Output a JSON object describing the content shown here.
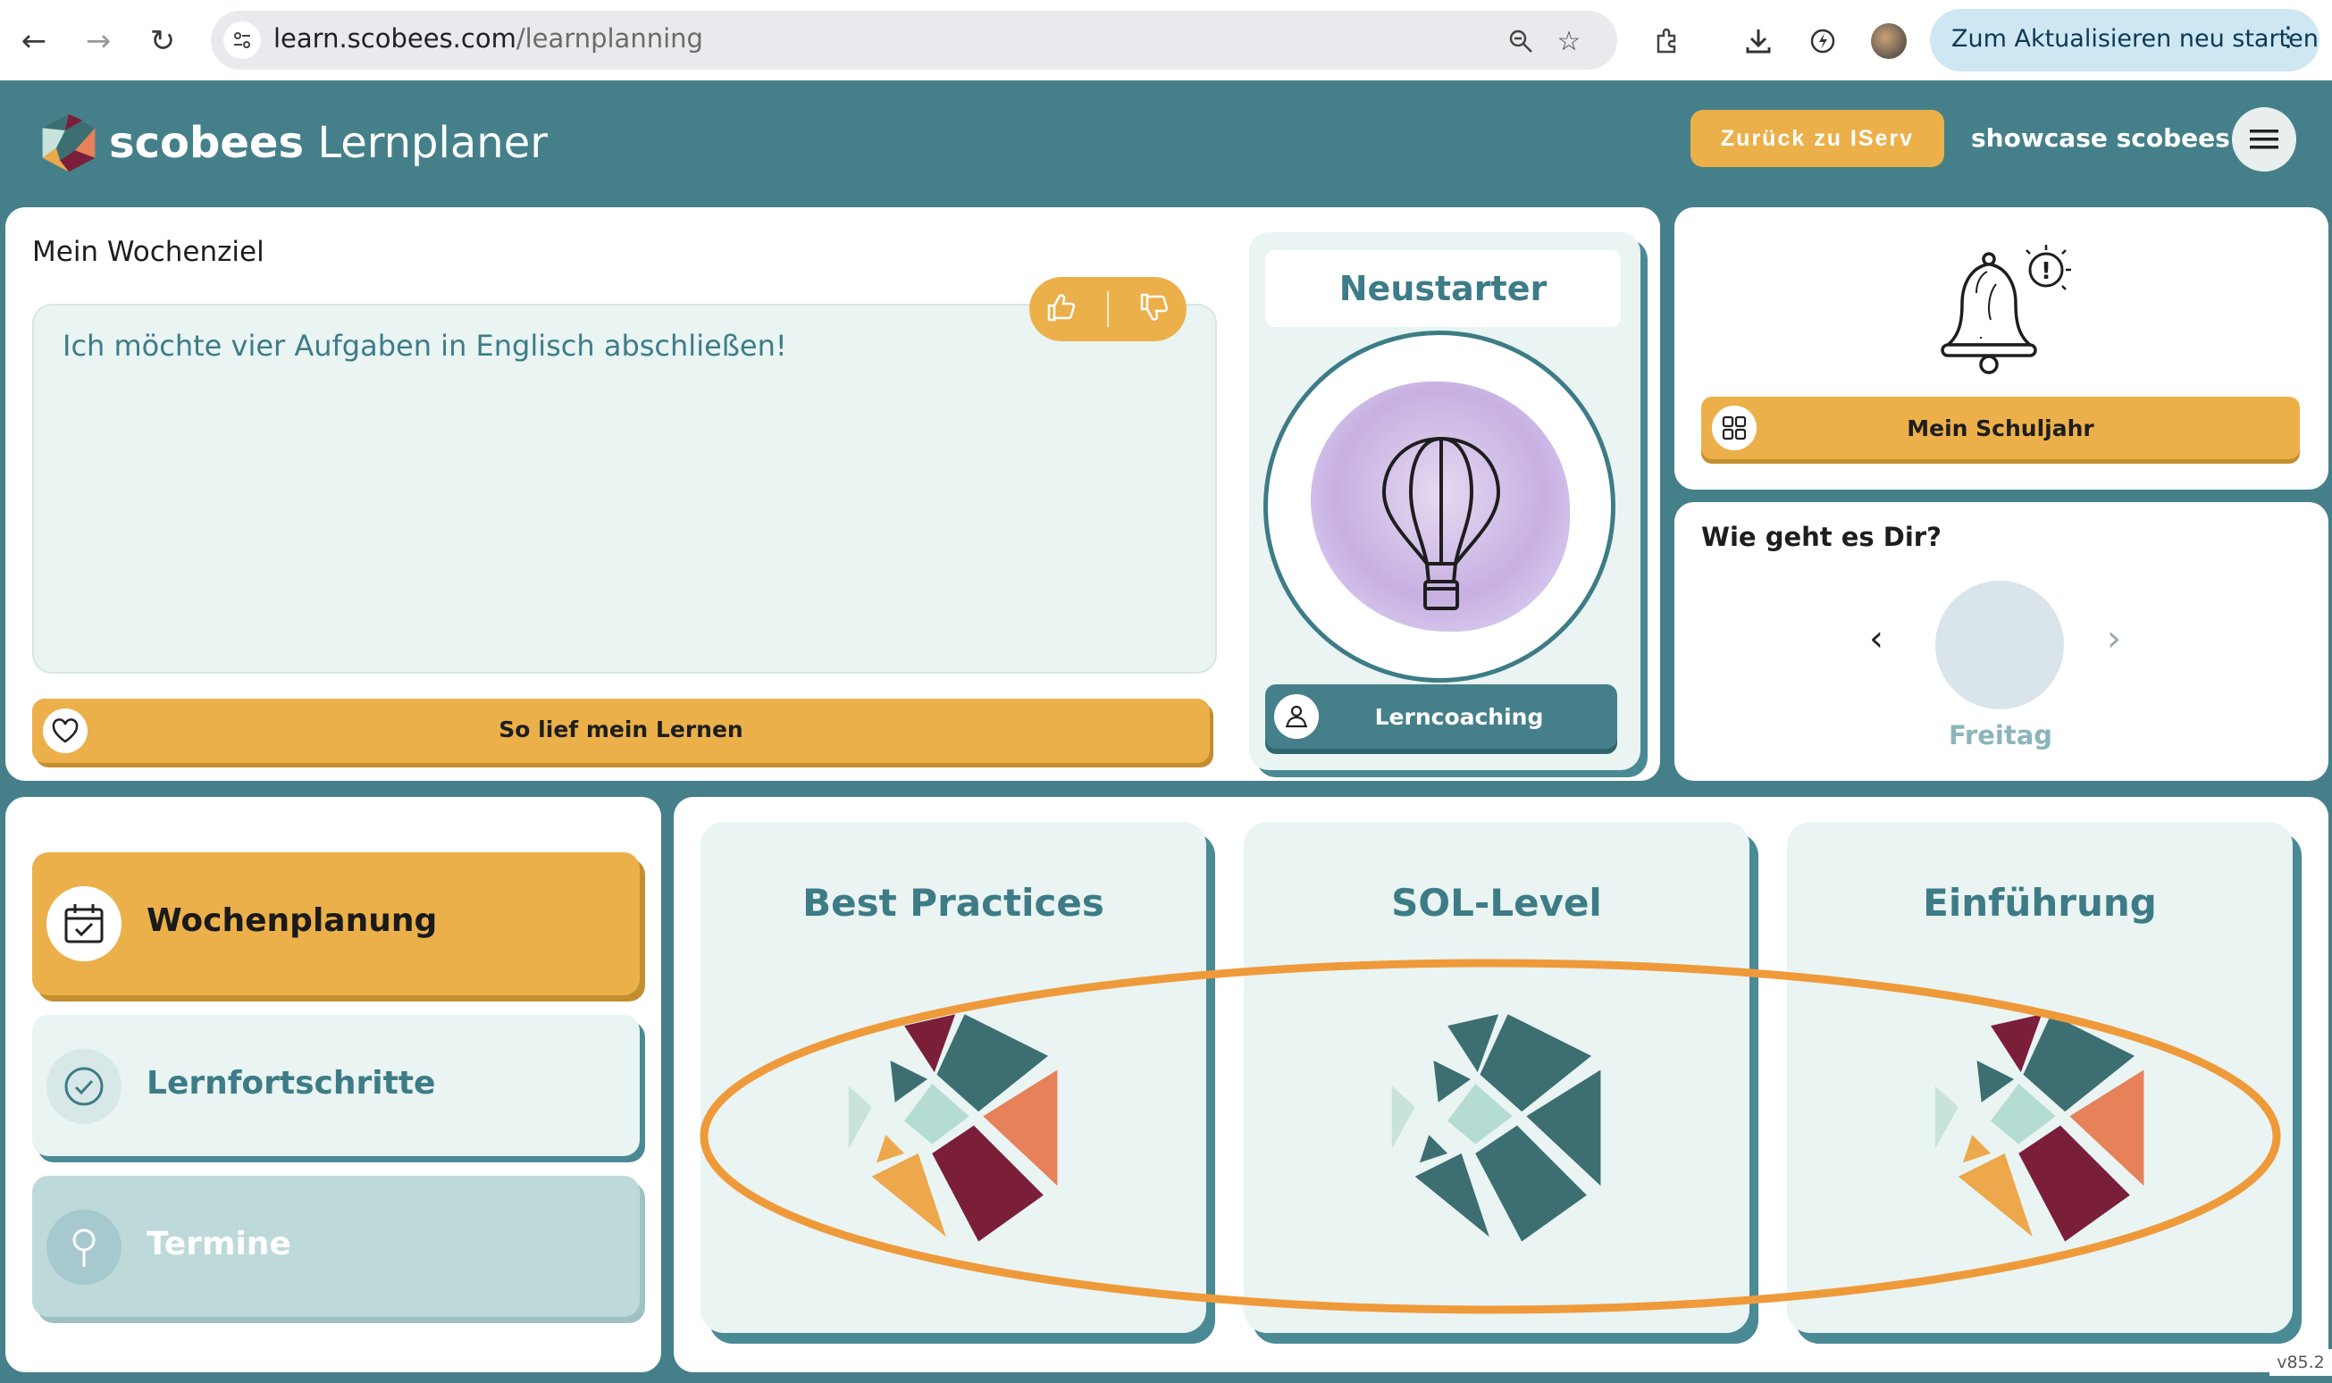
{
  "browser": {
    "url_domain": "learn.scobees.com",
    "url_path": "/learnplanning",
    "update_button": "Zum Aktualisieren neu starten"
  },
  "header": {
    "brand_bold": "scobees",
    "brand_light": "Lernplaner",
    "back_button": "Zurück zu IServ",
    "user_name": "showcase scobees"
  },
  "goal": {
    "title": "Mein Wochenziel",
    "text": "Ich möchte vier Aufgaben in Englisch abschließen!",
    "learn_button": "So lief mein Lernen"
  },
  "neustarter": {
    "title": "Neustarter",
    "coach_button": "Lerncoaching"
  },
  "school_year": {
    "button": "Mein Schuljahr"
  },
  "mood": {
    "title": "Wie geht es Dir?",
    "day": "Freitag"
  },
  "nav": {
    "wochenplanung": "Wochenplanung",
    "lernfortschritte": "Lernfortschritte",
    "termine": "Termine"
  },
  "tiles": {
    "best_practices": "Best Practices",
    "sol_level": "SOL-Level",
    "einfuehrung": "Einführung"
  },
  "version": "v85.2",
  "colors": {
    "teal": "#45808a",
    "teal_text": "#3d7c86",
    "amber": "#ecb04a",
    "mint": "#e9f4f3",
    "annotation": "#ef9a3a"
  }
}
